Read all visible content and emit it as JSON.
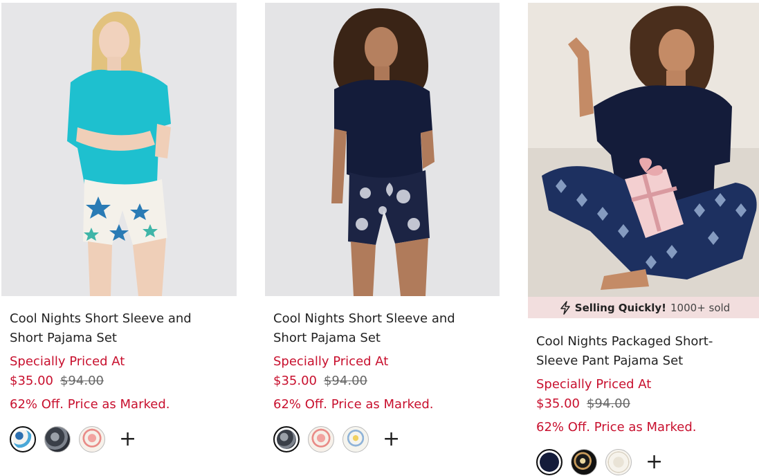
{
  "products": [
    {
      "title_line1": "Cool Nights Short Sleeve and",
      "title_line2": "Short Pajama Set",
      "promo": "Specially Priced At",
      "price": "$35.00",
      "original_price": "$94.00",
      "discount": "62% Off. Price as Marked.",
      "swatches": [
        "blue-seashell-print",
        "charcoal-floral-print",
        "pink-flamingo-print"
      ],
      "more_label": "+"
    },
    {
      "title_line1": "Cool Nights Short Sleeve and",
      "title_line2": "Short Pajama Set",
      "promo": "Specially Priced At",
      "price": "$35.00",
      "original_price": "$94.00",
      "discount": "62% Off. Price as Marked.",
      "swatches": [
        "charcoal-floral-print",
        "pink-flamingo-print",
        "yellow-floral-print"
      ],
      "more_label": "+"
    },
    {
      "badge_strong": "Selling Quickly!",
      "badge_text": "1000+ sold",
      "title_line1": "Cool Nights Packaged Short-",
      "title_line2": "Sleeve Pant Pajama Set",
      "promo": "Specially Priced At",
      "price": "$35.00",
      "original_price": "$94.00",
      "discount": "62% Off. Price as Marked.",
      "swatches": [
        "navy-solid",
        "black-floral-print",
        "ivory-print"
      ],
      "more_label": "+"
    }
  ],
  "colors": {
    "promo_red": "#c8102e",
    "badge_bg": "#f2dede",
    "navy": "#141c3a",
    "teal": "#1ec0cf"
  }
}
